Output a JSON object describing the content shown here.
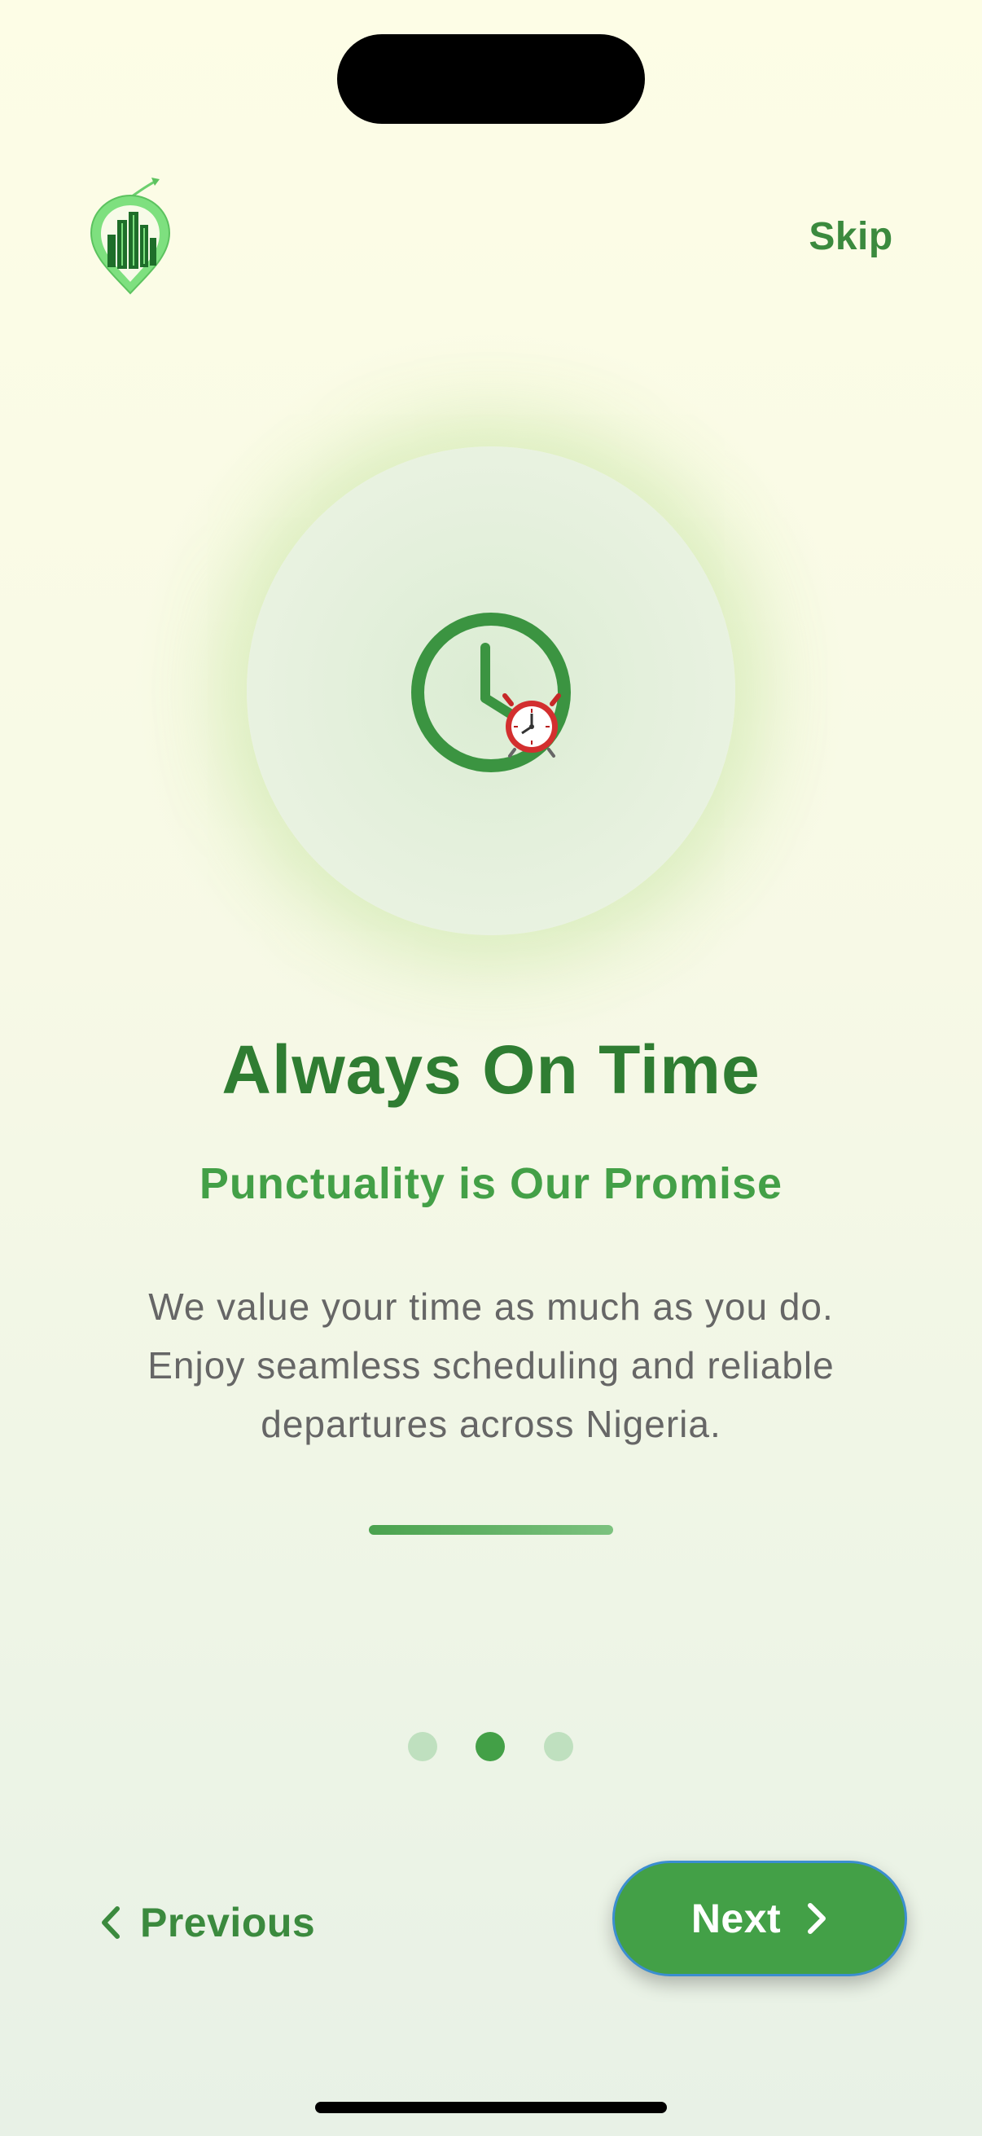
{
  "header": {
    "logo_icon": "city-location-pin-logo",
    "skip_label": "Skip"
  },
  "hero": {
    "icon": "clock-icon",
    "emoji": "⏰"
  },
  "content": {
    "title": "Always On Time",
    "subtitle": "Punctuality is Our Promise",
    "description_lines": [
      "We value your time as much as you do.",
      "Enjoy seamless scheduling and reliable",
      "departures across Nigeria."
    ]
  },
  "pagination": {
    "total": 3,
    "current": 2
  },
  "footer": {
    "previous_label": "Previous",
    "next_label": "Next"
  },
  "colors": {
    "primary": "#43a047",
    "primary_dark": "#2f7d32",
    "text_muted": "#666666",
    "background_top": "#fdfde6",
    "background_bottom": "#e8f1e6"
  }
}
